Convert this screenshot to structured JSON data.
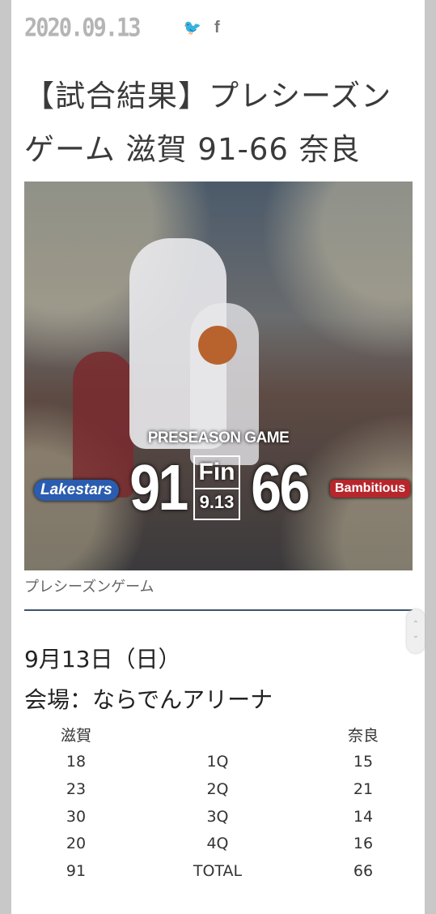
{
  "article": {
    "date": "2020.09.13",
    "title_line1": "【試合結果】プレシーズン",
    "title_line2": "ゲーム 滋賀 91-66 奈良",
    "share_twitter_icon": "twitter-icon",
    "share_facebook_icon": "facebook-icon",
    "twitter_glyph": "🐦",
    "facebook_glyph": "f"
  },
  "hero": {
    "banner": "PRESEASON GAME",
    "home_score": "91",
    "away_score": "66",
    "fin": "Fin",
    "fin_date": "9.13",
    "home_logo": "Lakestars",
    "away_logo": "Bambitious"
  },
  "caption": "プレシーズンゲーム",
  "game_info": {
    "date": "9月13日（日）",
    "venue": "会場：ならでんアリーナ"
  },
  "score_table": {
    "header": {
      "home": "滋賀",
      "quarter": "",
      "away": "奈良"
    },
    "rows": [
      {
        "home": "18",
        "quarter": "1Q",
        "away": "15"
      },
      {
        "home": "23",
        "quarter": "2Q",
        "away": "21"
      },
      {
        "home": "30",
        "quarter": "3Q",
        "away": "14"
      },
      {
        "home": "20",
        "quarter": "4Q",
        "away": "16"
      },
      {
        "home": "91",
        "quarter": "TOTAL",
        "away": "66"
      }
    ]
  },
  "scroll": {
    "up": "⌃",
    "down": "⌄"
  }
}
